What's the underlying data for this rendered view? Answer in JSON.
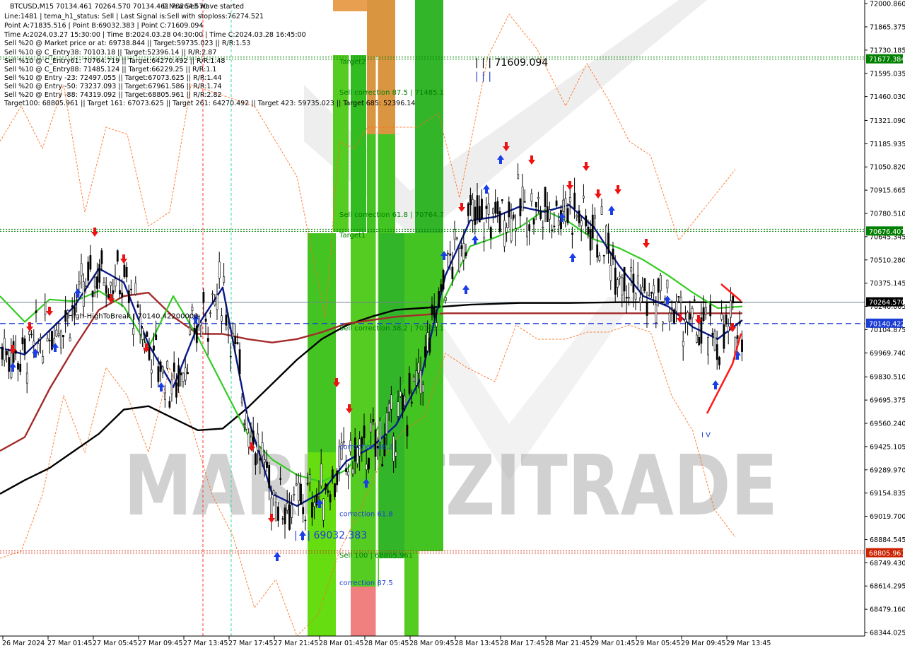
{
  "header": {
    "lines": [
      "BTCUSD,M15  70134.461 70264.570 70134.461 70264.570",
      "Line:1481 | tema_h1_status: Sell | Last Signal is:Sell with stoploss:76274.521",
      "Point A:71835.516 | Point B:69032.383 | Point C:71609.094",
      "Time A:2024.03.27 15:30:00 | Time B:2024.03.28 04:30:00 | Time C:2024.03.28 16:45:00",
      "Sell %20 @ Market price or at: 69738.844 || Target:59735.023 || R/R:1.53",
      "Sell %10 @ C_Entry38: 70103.18 || Target:52396.14 || R/R:2.87",
      "Sell %10 @ C_Entry61: 70764.719 || Target:64270.492 || R/R:1.48",
      "Sell %10 @ C_Entry88: 71485.124 || Target:66229.25 || R/R:1.1",
      "Sell %10 @ Entry -23: 72497.055 || Target:67073.625 || R/R:1.44",
      "Sell %20 @ Entry -50: 73237.093 || Target:67961.586 || R/R:1.74",
      "Sell %20 @ Entry -88: 74319.092 || Target:68805.961 || R/R:2.82",
      "Target100: 68805.961 || Target 161: 67073.625 || Target 261: 64270.492 || Target 423: 59735.023 || Target 685: 52396.14"
    ],
    "wave_status": "0 New Sell wave started"
  },
  "watermark": "MARKETZITRADE",
  "chart_data": {
    "type": "candlestick",
    "symbol": "BTCUSD",
    "timeframe": "M15",
    "ylim": [
      68344.025,
      72000.86
    ],
    "y_ticks": [
      "72000.860",
      "71865.375",
      "71730.185",
      "71595.035",
      "71460.030",
      "71321.090",
      "71185.935",
      "71050.820",
      "70915.665",
      "70780.510",
      "70645.345",
      "70510.280",
      "70375.145",
      "70240.005",
      "70104.875",
      "69969.740",
      "69830.510",
      "69695.375",
      "69560.240",
      "69425.105",
      "69289.970",
      "69154.835",
      "69019.700",
      "68884.545",
      "68749.430",
      "68614.295",
      "68479.160",
      "68344.025"
    ],
    "x_ticks": [
      "26 Mar 2024",
      "27 Mar 01:45",
      "27 Mar 05:45",
      "27 Mar 09:45",
      "27 Mar 13:45",
      "27 Mar 17:45",
      "27 Mar 21:45",
      "28 Mar 01:45",
      "28 Mar 05:45",
      "28 Mar 09:45",
      "28 Mar 13:45",
      "28 Mar 17:45",
      "28 Mar 21:45",
      "29 Mar 01:45",
      "29 Mar 05:45",
      "29 Mar 09:45",
      "29 Mar 13:45"
    ],
    "price_tags": [
      {
        "value": 71677.384,
        "label": "71677.384",
        "color": "#008000"
      },
      {
        "value": 70676.407,
        "label": "70676.407",
        "color": "#008000"
      },
      {
        "value": 70264.57,
        "label": "70264.570",
        "color": "#000000"
      },
      {
        "value": 70140.422,
        "label": "70140.422",
        "color": "#1c3ed4"
      },
      {
        "value": 68805.961,
        "label": "68805.961",
        "color": "#cc2200"
      }
    ],
    "hlines": [
      {
        "value": 71677.384,
        "color": "#008000",
        "style": "dotted"
      },
      {
        "value": 70676.407,
        "color": "#008000",
        "style": "dotted"
      },
      {
        "value": 70264.57,
        "color": "#708090",
        "style": "solid"
      },
      {
        "value": 70140.422,
        "color": "#1c3ed4",
        "style": "dashed"
      },
      {
        "value": 68805.961,
        "color": "#cc2200",
        "style": "dotted"
      }
    ],
    "annotations": [
      {
        "text": "Target2",
        "x_tick": "28 Mar 01:45",
        "value": 71650,
        "color": "#008000"
      },
      {
        "text": "Sell correction 87.5 | 71485.1",
        "x_tick": "28 Mar 01:45",
        "value": 71470,
        "color": "#008000"
      },
      {
        "text": "Sell correction 61.8 | 70764.7",
        "x_tick": "28 Mar 01:45",
        "value": 70760,
        "color": "#008000"
      },
      {
        "text": "Target1",
        "x_tick": "28 Mar 01:45",
        "value": 70640,
        "color": "#008000"
      },
      {
        "text": "Sell correction 38.2 | 70103.1",
        "x_tick": "28 Mar 01:45",
        "value": 70100,
        "color": "#008000"
      },
      {
        "text": "correction 38.2",
        "x_tick": "28 Mar 01:45",
        "value": 69410,
        "color": "#1c3ed4"
      },
      {
        "text": "correction 61.8",
        "x_tick": "28 Mar 01:45",
        "value": 69020,
        "color": "#1c3ed4"
      },
      {
        "text": "Sell 100 | 68805.961",
        "x_tick": "28 Mar 01:45",
        "value": 68780,
        "color": "#008000"
      },
      {
        "text": "correction 87.5",
        "x_tick": "28 Mar 01:45",
        "value": 68620,
        "color": "#1c3ed4"
      },
      {
        "text": "| | | 69032.383",
        "x_tick": "27 Mar 21:45",
        "value": 68890,
        "color": "#1c3ed4"
      },
      {
        "text": "| | | 71609.094",
        "x_tick": "28 Mar 13:45",
        "value": 71640,
        "color": "#000000"
      },
      {
        "text": "| | |",
        "x_tick": "28 Mar 13:45",
        "value": 71560,
        "color": "#1c3ed4"
      },
      {
        "text": "I V",
        "x_tick": "29 Mar 09:45",
        "value": 69480,
        "color": "#1c3ed4"
      },
      {
        "text": "High-HighToBreak | 70140.42200000",
        "x_tick": "27 Mar 01:45",
        "value": 70170,
        "color": "#000000"
      }
    ],
    "lines": {
      "tema_blue": [
        70000,
        69960,
        70100,
        70240,
        70460,
        70380,
        70020,
        69770,
        70130,
        70350,
        69600,
        69150,
        69080,
        69160,
        69340,
        69420,
        69550,
        69820,
        70420,
        70740,
        70760,
        70820,
        70790,
        70830,
        70700,
        70480,
        70300,
        70240,
        70120,
        70050,
        70160
      ],
      "ma_green": [
        70300,
        70150,
        70280,
        70270,
        70330,
        70240,
        70000,
        70300,
        70060,
        69780,
        69500,
        69350,
        69260,
        69220,
        69290,
        69470,
        69720,
        69920,
        70300,
        70590,
        70640,
        70700,
        70800,
        70730,
        70630,
        70580,
        70510,
        70420,
        70320,
        70230,
        70240
      ],
      "ma_darkred": [
        69400,
        69480,
        69760,
        70000,
        70220,
        70300,
        70320,
        70180,
        70080,
        70080,
        70050,
        70030,
        70050,
        70090,
        70140,
        70160,
        70180,
        70190,
        70200,
        70200,
        70200,
        70200,
        70200,
        70200,
        70200,
        70200,
        70200,
        70200,
        70200,
        70200,
        70200
      ],
      "ma_black": [
        69150,
        69230,
        69300,
        69400,
        69500,
        69640,
        69660,
        69590,
        69520,
        69530,
        69650,
        69790,
        69930,
        70050,
        70130,
        70180,
        70220,
        70230,
        70240,
        70250,
        70255,
        70260,
        70260,
        70260,
        70262,
        70264,
        70264,
        70264,
        70264,
        70264,
        70264
      ]
    }
  }
}
